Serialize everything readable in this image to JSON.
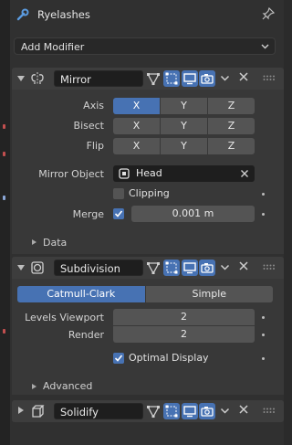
{
  "header": {
    "title": "Ryelashes"
  },
  "add_modifier": {
    "label": "Add Modifier"
  },
  "mirror": {
    "name": "Mirror",
    "axis_label": "Axis",
    "bisect_label": "Bisect",
    "flip_label": "Flip",
    "axes": [
      "X",
      "Y",
      "Z"
    ],
    "axis_selected": "X",
    "mirror_object_label": "Mirror Object",
    "mirror_object_value": "Head",
    "clipping_label": "Clipping",
    "clipping_checked": false,
    "merge_label": "Merge",
    "merge_checked": true,
    "merge_value": "0.001 m",
    "data_label": "Data"
  },
  "subdivision": {
    "name": "Subdivision",
    "mode_options": [
      "Catmull-Clark",
      "Simple"
    ],
    "mode_selected": "Catmull-Clark",
    "levels_viewport_label": "Levels Viewport",
    "levels_viewport_value": "2",
    "render_label": "Render",
    "render_value": "2",
    "optimal_display_label": "Optimal Display",
    "optimal_display_checked": true,
    "advanced_label": "Advanced"
  },
  "solidify": {
    "name": "Solidify"
  },
  "colors": {
    "accent": "#4772b3",
    "panel": "#303030",
    "field": "#545454"
  }
}
